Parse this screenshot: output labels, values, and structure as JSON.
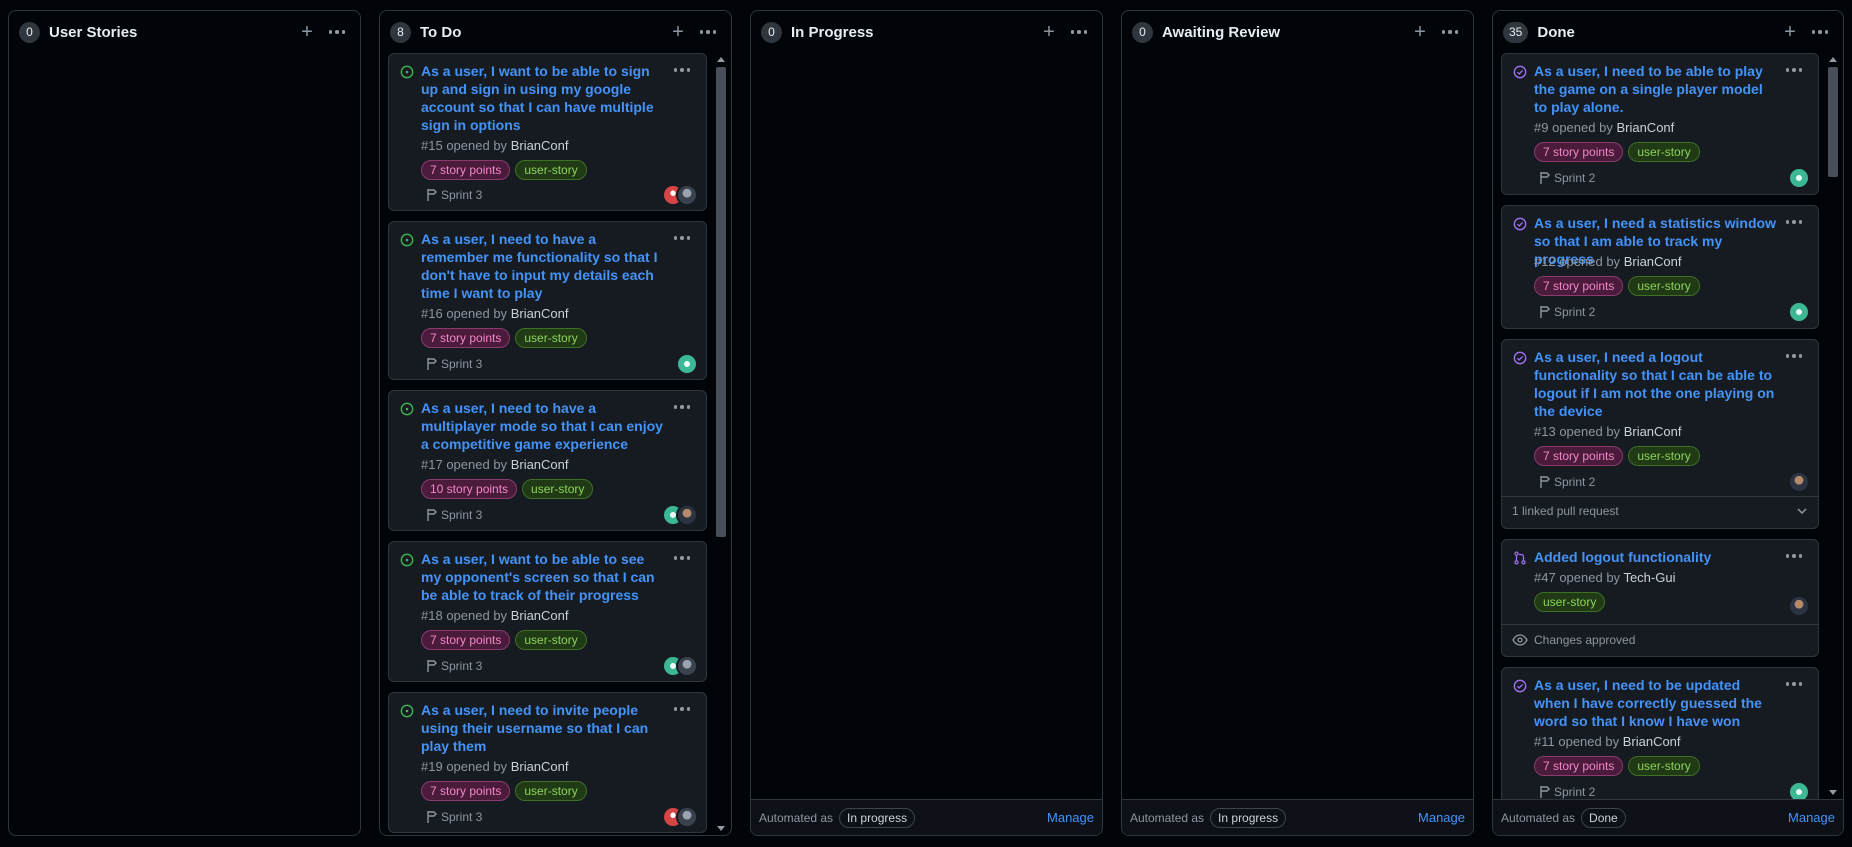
{
  "columns": [
    {
      "title": "User Stories",
      "count": "0"
    },
    {
      "title": "To Do",
      "count": "8"
    },
    {
      "title": "In Progress",
      "count": "0",
      "automated": "Automated as",
      "automated_value": "In progress",
      "manage": "Manage"
    },
    {
      "title": "Awaiting Review",
      "count": "0",
      "automated": "Automated as",
      "automated_value": "In progress",
      "manage": "Manage"
    },
    {
      "title": "Done",
      "count": "35",
      "automated": "Automated as",
      "automated_value": "Done",
      "manage": "Manage"
    }
  ],
  "todo_cards": [
    {
      "title": "As a user, I want to be able to sign up and sign in using my google account so that I can have multiple sign in options",
      "number": "#15",
      "opened_by": "opened by",
      "author": "BrianConf",
      "points": "7 story points",
      "tag": "user-story",
      "sprint": "Sprint 3"
    },
    {
      "title": "As a user, I need to have a remember me functionality so that I don't have to input my details each time I want to play",
      "number": "#16",
      "opened_by": "opened by",
      "author": "BrianConf",
      "points": "7 story points",
      "tag": "user-story",
      "sprint": "Sprint 3"
    },
    {
      "title": "As a user, I need to have a multiplayer mode so that I can enjoy a competitive game experience",
      "number": "#17",
      "opened_by": "opened by",
      "author": "BrianConf",
      "points": "10 story points",
      "tag": "user-story",
      "sprint": "Sprint 3"
    },
    {
      "title": "As a user, I want to be able to see my opponent's screen so that I can be able to track of their progress",
      "number": "#18",
      "opened_by": "opened by",
      "author": "BrianConf",
      "points": "7 story points",
      "tag": "user-story",
      "sprint": "Sprint 3"
    },
    {
      "title": "As a user, I need to invite people using their username so that I can play them",
      "number": "#19",
      "opened_by": "opened by",
      "author": "BrianConf",
      "points": "7 story points",
      "tag": "user-story",
      "sprint": "Sprint 3"
    }
  ],
  "done_cards": [
    {
      "title": "As a user, I need to be able to play the game on a single player model to play alone.",
      "number": "#9",
      "opened_by": "opened by",
      "author": "BrianConf",
      "points": "7 story points",
      "tag": "user-story",
      "sprint": "Sprint 2"
    },
    {
      "title": "As a user, I need a statistics window so that I am able to track my progress",
      "number": "#12",
      "opened_by": "opened by",
      "author": "BrianConf",
      "points": "7 story points",
      "tag": "user-story",
      "sprint": "Sprint 2"
    },
    {
      "title": "As a user, I need a logout functionality so that I can be able to logout if I am not the one playing on the device",
      "number": "#13",
      "opened_by": "opened by",
      "author": "BrianConf",
      "points": "7 story points",
      "tag": "user-story",
      "sprint": "Sprint 2",
      "linked": "1 linked pull request"
    },
    {
      "title": "Added logout functionality",
      "number": "#47",
      "opened_by": "opened by",
      "author": "Tech-Gui",
      "tag": "user-story",
      "status": "Changes approved"
    },
    {
      "title": "As a user, I need to be updated when I have correctly guessed the word so that I know I have won",
      "number": "#11",
      "opened_by": "opened by",
      "author": "BrianConf",
      "points": "7 story points",
      "tag": "user-story",
      "sprint": "Sprint 2"
    }
  ],
  "colors": {
    "accent": "#4493f8",
    "open_issue": "#3fb950",
    "closed_issue": "#a371f7",
    "background": "#010409"
  },
  "icons": {
    "open": "issue-opened-icon",
    "closed": "issue-closed-icon",
    "pr": "git-pull-request-icon",
    "milestone": "milestone-icon",
    "eye": "eye-icon",
    "chevron": "chevron-down-icon"
  }
}
